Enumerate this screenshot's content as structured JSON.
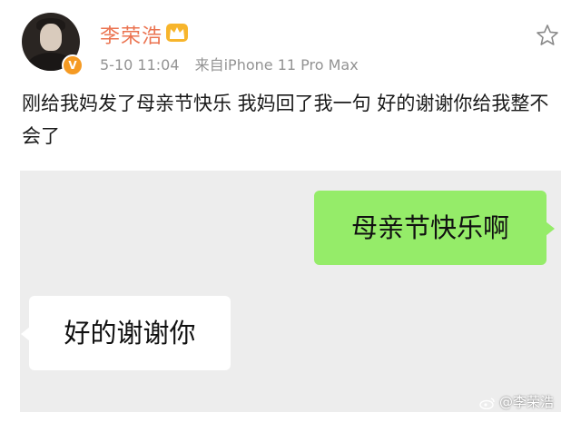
{
  "post": {
    "username": "李荣浩",
    "date": "5-10 11:04",
    "source": "来自iPhone 11 Pro Max",
    "text": "刚给我妈发了母亲节快乐 我妈回了我一句 好的谢谢你给我整不会了"
  },
  "chat": {
    "sent_message": "母亲节快乐啊",
    "received_message": "好的谢谢你"
  },
  "watermark": "@李荣浩",
  "icons": {
    "crown": "crown-icon",
    "verified": "verified-badge-icon",
    "favorite": "star-icon",
    "weibo": "weibo-logo-icon"
  },
  "colors": {
    "username": "#eb7350",
    "verified": "#f59a23",
    "sent_bubble": "#95ec69",
    "chat_bg": "#ededed"
  }
}
